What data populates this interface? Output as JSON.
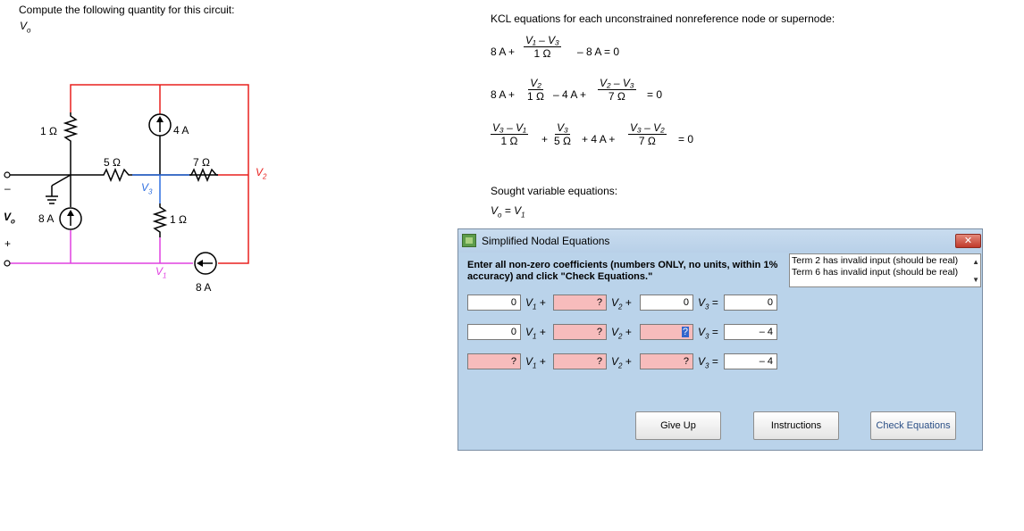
{
  "problem": {
    "prompt": "Compute the following quantity for this circuit:",
    "quantity": "V",
    "quantity_sub": "o"
  },
  "circuit": {
    "r1_label": "1 Ω",
    "r5_label": "5 Ω",
    "r7_label": "7 Ω",
    "r1b_label": "1 Ω",
    "src4_label": "4 A",
    "src8a_label": "8 A",
    "src8b_label": "8 A",
    "node_v1": "V",
    "node_v1_sub": "1",
    "node_v2": "V",
    "node_v2_sub": "2",
    "node_v3": "V",
    "node_v3_sub": "3",
    "vo": "V",
    "vo_sub": "o",
    "minus": "–",
    "plus": "+",
    "colors": {
      "red": "#e8201e",
      "blue": "#2f6fe0",
      "magenta": "#e040e0",
      "black": "#000000"
    }
  },
  "kcl": {
    "heading": "KCL equations for each unconstrained nonreference node or supernode:",
    "eq1": {
      "lead": "8 A +",
      "num": "V₁ – V₃",
      "den": "1 Ω",
      "tail": "– 8 A = 0"
    },
    "eq2": {
      "lead": "8 A +",
      "num1": "V₂",
      "den1": "1 Ω",
      "mid": "– 4 A +",
      "num2": "V₂ – V₃",
      "den2": "7 Ω",
      "tail": "= 0"
    },
    "eq3": {
      "num1": "V₃ – V₁",
      "den1": "1 Ω",
      "op1": "+",
      "num2": "V₃",
      "den2": "5 Ω",
      "mid": "+ 4 A +",
      "num3": "V₃ – V₂",
      "den3": "7 Ω",
      "tail": "= 0"
    }
  },
  "sought": {
    "heading": "Sought variable equations:",
    "eq": "V",
    "eq_sub": "o",
    "eq_rest": " = V",
    "eq_rest_sub": "1"
  },
  "dialog": {
    "title": "Simplified Nodal Equations",
    "close": "✕",
    "instructions": "Enter all non-zero coefficients (numbers ONLY, no units, within 1% accuracy) and click \"Check Equations.\"",
    "errors": [
      "Term 2 has invalid input (should be real)",
      "Term 6 has invalid input (should be real)"
    ],
    "rows": [
      {
        "c1": "0",
        "c2": "?",
        "c3": "0",
        "rhs": "0"
      },
      {
        "c1": "0",
        "c2": "?",
        "c3": "?",
        "rhs": "– 4"
      },
      {
        "c1": "?",
        "c2": "?",
        "c3": "?",
        "rhs": "– 4"
      }
    ],
    "v1": "V",
    "v1_sub": "1",
    "v2": "V",
    "v2_sub": "2",
    "v3": "V",
    "v3_sub": "3",
    "plus": "+",
    "eq": "=",
    "buttons": {
      "give_up": "Give Up",
      "instructions": "Instructions",
      "check": "Check Equations"
    }
  }
}
